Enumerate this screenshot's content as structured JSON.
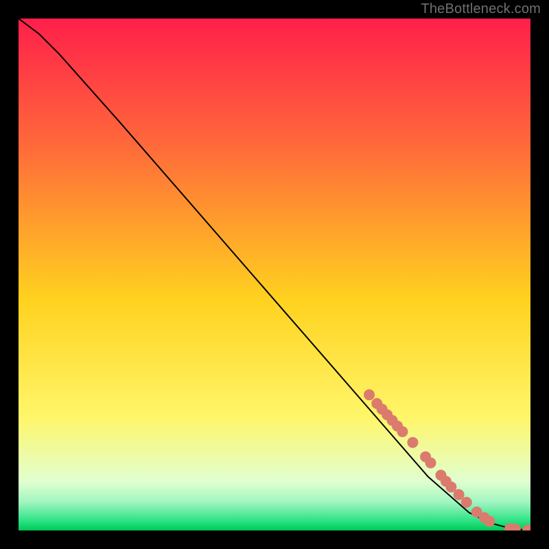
{
  "attribution": "TheBottleneck.com",
  "colors": {
    "background": "#000000",
    "gradient_top": "#ff1f4a",
    "gradient_mid_upper": "#ff6a3a",
    "gradient_mid": "#ffd21f",
    "gradient_mid_lower": "#fff66a",
    "gradient_green_light": "#e0ffd0",
    "gradient_green_pale": "#a0f5c0",
    "gradient_green_strong": "#21e07d",
    "gradient_green_line": "#00c853",
    "curve": "#000000",
    "dots": "#db7b6e"
  },
  "chart_data": {
    "type": "line",
    "title": "",
    "xlabel": "",
    "ylabel": "",
    "xlim": [
      0,
      100
    ],
    "ylim": [
      0,
      100
    ],
    "series": [
      {
        "name": "curve",
        "x": [
          0,
          4,
          8,
          12,
          20,
          30,
          40,
          50,
          60,
          70,
          80,
          88,
          92,
          95,
          97,
          99,
          100
        ],
        "y": [
          100,
          97,
          93,
          88.5,
          79.5,
          68,
          56.5,
          45,
          33.5,
          22,
          10.5,
          3.5,
          1.5,
          0.7,
          0.3,
          0.1,
          0.1
        ]
      }
    ],
    "highlight_dots": {
      "name": "dots",
      "points": [
        [
          68.5,
          26.5
        ],
        [
          70.0,
          24.8
        ],
        [
          71.0,
          23.7
        ],
        [
          72.0,
          22.6
        ],
        [
          73.0,
          21.5
        ],
        [
          74.0,
          20.4
        ],
        [
          75.0,
          19.3
        ],
        [
          77.0,
          17.2
        ],
        [
          79.5,
          14.4
        ],
        [
          80.5,
          13.2
        ],
        [
          82.5,
          10.8
        ],
        [
          83.5,
          9.6
        ],
        [
          84.5,
          8.5
        ],
        [
          86.0,
          7.0
        ],
        [
          87.5,
          5.5
        ],
        [
          89.5,
          3.6
        ],
        [
          91.0,
          2.5
        ],
        [
          92.0,
          1.8
        ],
        [
          96.0,
          0.35
        ],
        [
          97.0,
          0.3
        ],
        [
          99.5,
          0.1
        ],
        [
          100.0,
          0.1
        ]
      ]
    },
    "gradient_stops": [
      {
        "offset": 0.0,
        "color": "gradient_top"
      },
      {
        "offset": 0.25,
        "color": "gradient_mid_upper"
      },
      {
        "offset": 0.55,
        "color": "gradient_mid"
      },
      {
        "offset": 0.78,
        "color": "gradient_mid_lower"
      },
      {
        "offset": 0.905,
        "color": "gradient_green_light"
      },
      {
        "offset": 0.945,
        "color": "gradient_green_pale"
      },
      {
        "offset": 0.985,
        "color": "gradient_green_strong"
      },
      {
        "offset": 1.0,
        "color": "gradient_green_line"
      }
    ]
  }
}
